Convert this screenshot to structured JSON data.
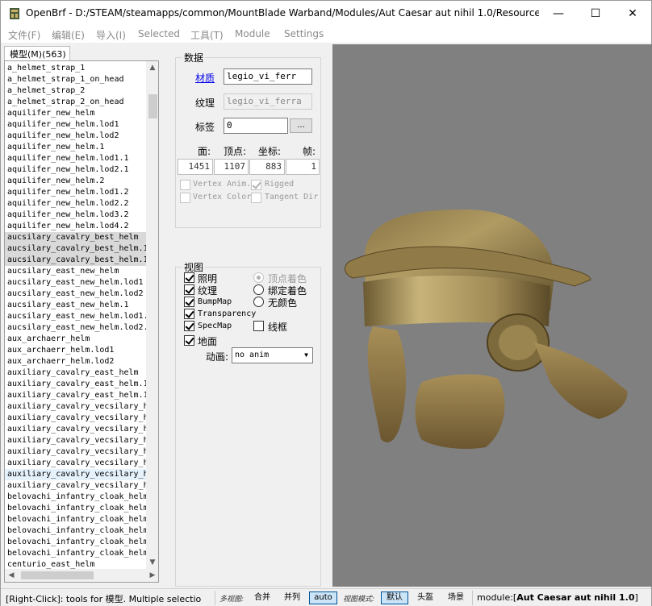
{
  "window": {
    "title": "OpenBrf - D:/STEAM/steamapps/common/MountBlade Warband/Modules/Aut Caesar aut nihil 1.0/Resource/...",
    "minimize_glyph": "—",
    "maximize_glyph": "☐",
    "close_glyph": "✕"
  },
  "menu": [
    "文件(F)",
    "编辑(E)",
    "导入(I)",
    "Selected",
    "工具(T)",
    "Module",
    "Settings"
  ],
  "tab": {
    "label": "模型(M)(563)"
  },
  "list": {
    "items": [
      "a_helmet_strap_1",
      "a_helmet_strap_1_on_head",
      "a_helmet_strap_2",
      "a_helmet_strap_2_on_head",
      "aquilifer_new_helm",
      "aquilifer_new_helm.lod1",
      "aquilifer_new_helm.lod2",
      "aquilifer_new_helm.1",
      "aquilifer_new_helm.lod1.1",
      "aquilifer_new_helm.lod2.1",
      "aquilifer_new_helm.2",
      "aquilifer_new_helm.lod1.2",
      "aquilifer_new_helm.lod2.2",
      "aquilifer_new_helm.lod3.2",
      "aquilifer_new_helm.lod4.2",
      "aucsilary_cavalry_best_helm",
      "aucsilary_cavalry_best_helm.1",
      "aucsilary_cavalry_best_helm.1",
      "aucsilary_east_new_helm",
      "aucsilary_east_new_helm.lod1",
      "aucsilary_east_new_helm.lod2",
      "aucsilary_east_new_helm.1",
      "aucsilary_east_new_helm.lod1.",
      "aucsilary_east_new_helm.lod2.",
      "aux_archaerr_helm",
      "aux_archaerr_helm.lod1",
      "aux_archaerr_helm.lod2",
      "auxiliary_cavalry_east_helm",
      "auxiliary_cavalry_east_helm.1",
      "auxiliary_cavalry_east_helm.1",
      "auxiliary_cavalry_vecsilary_h",
      "auxiliary_cavalry_vecsilary_h",
      "auxiliary_cavalry_vecsilary_h",
      "auxiliary_cavalry_vecsilary_h",
      "auxiliary_cavalry_vecsilary_h",
      "auxiliary_cavalry_vecsilary_h",
      "auxiliary_cavalry_vecsilary_h",
      "auxiliary_cavalry_vecsilary_h",
      "belovachi_infantry_cloak_helm",
      "belovachi_infantry_cloak_helm",
      "belovachi_infantry_cloak_helm",
      "belovachi_infantry_cloak_helm",
      "belovachi_infantry_cloak_helm",
      "belovachi_infantry_cloak_helm",
      "centurio_east_helm"
    ],
    "selected_indices": [
      15,
      16,
      17
    ],
    "hover_index": 36
  },
  "data_panel": {
    "title": "数据",
    "material_label": "材质",
    "material_value": "legio_vi_ferr",
    "texture_label": "纹理",
    "texture_value": "legio_vi_ferra",
    "flags_label": "标签",
    "flags_value": "0",
    "flags_button": "...",
    "stat_headers": [
      "面:",
      "顶点:",
      "坐标:",
      "帧:"
    ],
    "stat_values": [
      "1451",
      "1107",
      "883",
      "1"
    ],
    "checkboxes": [
      {
        "label": "Vertex Anim.",
        "checked": false
      },
      {
        "label": "Rigged",
        "checked": true
      },
      {
        "label": "Vertex Color",
        "checked": false
      },
      {
        "label": "Tangent Dir",
        "checked": false
      }
    ]
  },
  "view_panel": {
    "title": "视图",
    "lighting": "照明",
    "texture": "纹理",
    "bumpmap": "BumpMap",
    "transparency": "Transparency",
    "specmap": "SpecMap",
    "ground": "地面",
    "radio_vertex": "顶点着色",
    "radio_bound": "绑定着色",
    "radio_none": "无颜色",
    "wireframe": "线框",
    "anim_label": "动画:",
    "anim_value": "no anim"
  },
  "status": {
    "hint": "[Right-Click]: tools for 模型. Multiple selectio",
    "multi_label": "多视图:",
    "combine": "合并",
    "side": "并列",
    "auto": "auto",
    "mode_label": "视图模式:",
    "default": "默认",
    "helmet": "头盔",
    "scene": "场景",
    "module_prefix": "module:[",
    "module_name": "Aut Caesar aut nihil 1.0",
    "module_suffix": "]"
  },
  "colors": {
    "viewport_bg": "#808080",
    "helmet_bronze": "#a08a55",
    "active_button": "#cce4f7",
    "link_blue": "#0000ee"
  }
}
